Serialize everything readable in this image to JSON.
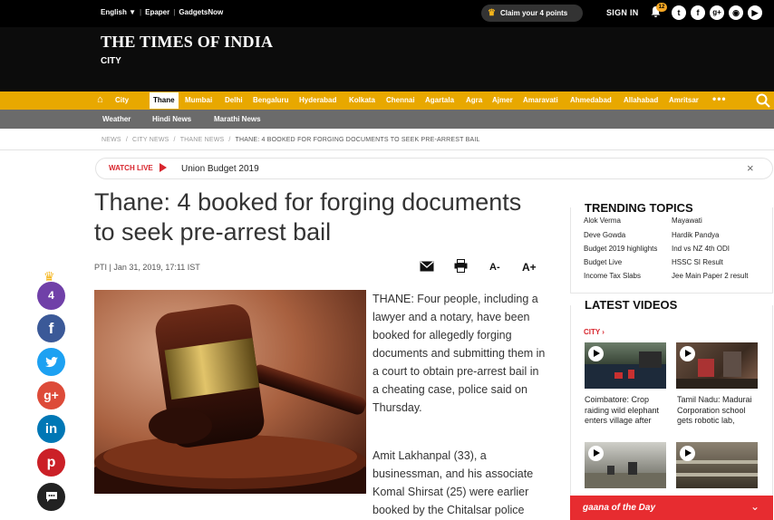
{
  "topbar": {
    "language": "English",
    "language_arrow": "▼",
    "epaper": "Epaper",
    "gadgets": "GadgetsNow",
    "sep": "|",
    "claim": "Claim your 4 points",
    "signin": "SIGN IN",
    "notif_count": "12",
    "social": [
      "twitter-icon",
      "facebook-icon",
      "google-plus-icon",
      "rss-icon",
      "youtube-icon"
    ]
  },
  "masthead": {
    "logo": "THE TIMES OF INDIA",
    "section": "CITY"
  },
  "citynav": {
    "home_icon": "home-icon",
    "city": "City",
    "active": "Thane",
    "items": [
      "Mumbai",
      "Delhi",
      "Bengaluru",
      "Hyderabad",
      "Kolkata",
      "Chennai",
      "Agartala",
      "Agra",
      "Ajmer",
      "Amaravati",
      "Ahmedabad",
      "Allahabad",
      "Amritsar"
    ],
    "more": "•••"
  },
  "subnav": {
    "items": [
      "Weather",
      "Hindi News",
      "Marathi News"
    ]
  },
  "breadcrumb": {
    "items": [
      "NEWS",
      "CITY NEWS",
      "THANE NEWS"
    ],
    "sep": "/",
    "current": "THANE: 4 BOOKED FOR FORGING DOCUMENTS TO SEEK PRE-ARREST BAIL"
  },
  "watch_live": {
    "label": "WATCH LIVE",
    "topic": "Union Budget 2019",
    "close": "×"
  },
  "article": {
    "headline": "Thane: 4 booked for forging documents to seek pre-arrest bail",
    "byline": "PTI | Jan 31, 2019, 17:11 IST",
    "font_smaller": "A-",
    "font_larger": "A+",
    "paragraphs": [
      "THANE: Four people, including a lawyer and a notary, have been booked for allegedly forging documents and submitting them in a court to obtain pre-arrest bail in a cheating case, police said on Thursday.",
      "Amit Lakhanpal (33), a businessman, and his associate Komal Shirsat (25) were earlier booked by the Chitalsar police"
    ]
  },
  "share": {
    "points": "4",
    "buttons": [
      {
        "name": "facebook-share-button",
        "glyph": "f",
        "color": "#3b5998"
      },
      {
        "name": "twitter-share-button",
        "glyph": "t",
        "color": "#1da1f2"
      },
      {
        "name": "google-plus-share-button",
        "glyph": "g+",
        "color": "#dd4b39"
      },
      {
        "name": "linkedin-share-button",
        "glyph": "in",
        "color": "#0077b5"
      },
      {
        "name": "pinterest-share-button",
        "glyph": "p",
        "color": "#cb2027"
      },
      {
        "name": "comment-button",
        "glyph": "▪",
        "color": "#222222"
      }
    ]
  },
  "trending": {
    "title": "TRENDING TOPICS",
    "left": [
      "Alok Verma",
      "Deve Gowda",
      "Budget 2019 highlights",
      "Budget Live",
      "Income Tax Slabs"
    ],
    "right": [
      "Mayawati",
      "Hardik Pandya",
      "Ind vs NZ 4th ODI",
      "HSSC SI Result",
      "Jee Main Paper 2 result"
    ]
  },
  "videos": {
    "title": "LATEST VIDEOS",
    "city_label": "CITY ›",
    "items": [
      {
        "caption": "Coimbatore: Crop raiding wild elephant enters village after"
      },
      {
        "caption": "Tamil Nadu: Madurai Corporation school gets robotic lab,"
      },
      {
        "caption": ""
      },
      {
        "caption": ""
      }
    ]
  },
  "gaana": {
    "label": "gaana of the Day",
    "chevron": "⌄"
  },
  "colors": {
    "nav_yellow": "#e8a800",
    "subnav_gray": "#6b6b6b",
    "accent_red": "#d8262e"
  }
}
